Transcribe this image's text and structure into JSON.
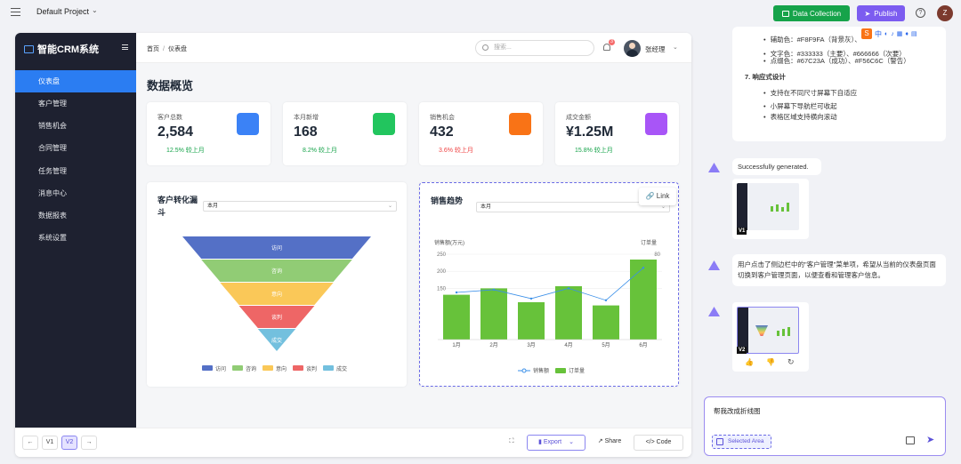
{
  "topbar": {
    "project": "Default Project",
    "data_collection": "Data Collection",
    "publish": "Publish",
    "user_initial": "Z",
    "help": "?"
  },
  "crm": {
    "brand": "智能CRM系统",
    "nav": [
      "仪表盘",
      "客户管理",
      "销售机会",
      "合同管理",
      "任务管理",
      "消息中心",
      "数据报表",
      "系统设置"
    ],
    "crumb_home": "首页",
    "crumb_sep": "/",
    "crumb_current": "仪表盘",
    "search_placeholder": "搜索...",
    "bell_count": "3",
    "user_name": "张经理",
    "page_title": "数据概览",
    "cards": [
      {
        "label": "客户总数",
        "value": "2,584",
        "change": "12.5% 较上月",
        "change_color": "#16a34a",
        "color": "#3b82f6"
      },
      {
        "label": "本月新增",
        "value": "168",
        "change": "8.2% 较上月",
        "change_color": "#16a34a",
        "color": "#22c55e"
      },
      {
        "label": "销售机会",
        "value": "432",
        "change": "3.6% 较上月",
        "change_color": "#ef4444",
        "color": "#f97316"
      },
      {
        "label": "成交金额",
        "value": "¥1.25M",
        "change": "15.8% 较上月",
        "change_color": "#16a34a",
        "color": "#a855f7"
      }
    ],
    "funnel": {
      "title": "客户转化漏斗",
      "period": "本月"
    },
    "sales": {
      "title": "销售趋势",
      "period": "本月",
      "link": "Link"
    }
  },
  "chart_data": [
    {
      "type": "funnel",
      "categories": [
        "访问",
        "咨询",
        "意向",
        "谈判",
        "成交"
      ],
      "colors": [
        "#5470c6",
        "#91cc75",
        "#fac858",
        "#ee6666",
        "#73c0de"
      ]
    },
    {
      "type": "bar",
      "categories": [
        "1月",
        "2月",
        "3月",
        "4月",
        "5月",
        "6月"
      ],
      "ylabel": "销售额(万元)",
      "y2label": "订单量",
      "ylim": [
        0,
        250
      ],
      "yticks": [
        "250",
        "200",
        "150"
      ],
      "y2ticks": [
        "80"
      ],
      "series": [
        {
          "name": "销售额",
          "type": "line",
          "values": [
            138,
            146,
            120,
            150,
            115,
            210
          ],
          "color": "#3a8fe8"
        },
        {
          "name": "订单量",
          "type": "bar",
          "values": [
            42,
            48,
            35,
            50,
            32,
            75
          ],
          "color": "#67c23a"
        }
      ]
    }
  ],
  "preview_footer": {
    "v1": "V1",
    "v2": "V2",
    "export": "Export",
    "share": "Share",
    "code": "Code"
  },
  "assistant": {
    "spec_lines": [
      "辅助色：#F8F9FA（背景灰）、",
      "文字色：#333333（主要）、#666666（次要）",
      "点缀色：#67C23A（成功）、#F56C6C（警告）"
    ],
    "section_title": "7. 响应式设计",
    "section_items": [
      "支持在不同尺寸屏幕下自适应",
      "小屏幕下导航栏可收起",
      "表格区域支持横向滚动"
    ],
    "msg1": "Successfully generated.",
    "thumb1": "V1",
    "msg2": "用户点击了侧边栏中的\"客户管理\"菜单项，希望从当前的仪表盘页面切换到客户管理页面，以便查看和管理客户信息。",
    "thumb2": "V2",
    "input_text": "帮我改成折线图",
    "selected_area": "Selected Area",
    "ime": "中"
  }
}
